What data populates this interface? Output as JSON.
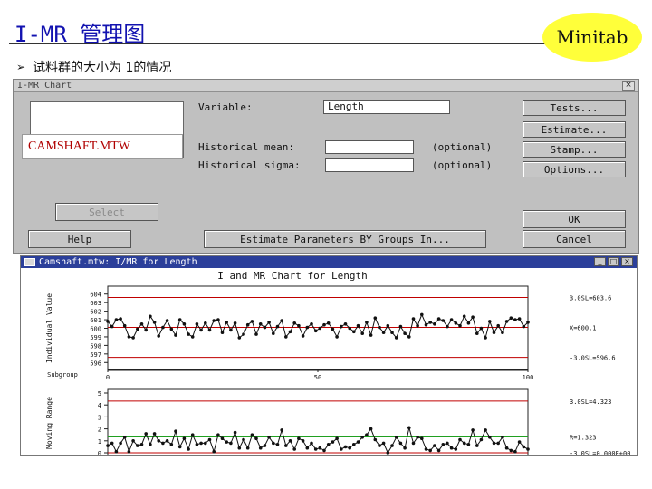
{
  "slide": {
    "title": "I-MR 管理图",
    "logo": "Minitab",
    "bullet_icon": "arrow-bullet-icon",
    "bullet": "试料群的大小为 1的情况"
  },
  "dialog": {
    "title": "I-MR Chart",
    "close": "×",
    "dataset": "CAMSHAFT.MTW",
    "variable_label": "Variable:",
    "variable_value": "Length",
    "hist_mean_label": "Historical mean:",
    "hist_mean_value": "",
    "hist_sigma_label": "Historical sigma:",
    "hist_sigma_value": "",
    "optional1": "(optional)",
    "optional2": "(optional)",
    "buttons": {
      "tests": "Tests...",
      "estimate": "Estimate...",
      "stamp": "Stamp...",
      "options": "Options...",
      "select": "Select",
      "ok": "OK",
      "help": "Help",
      "estimate_by": "Estimate Parameters BY Groups In...",
      "cancel": "Cancel"
    }
  },
  "chart_window": {
    "title": "Camshaft.mtw: I/MR for Length",
    "controls": [
      "_",
      "□",
      "×"
    ],
    "chart_title": "I and MR Chart for Length"
  },
  "chart_data": [
    {
      "type": "line",
      "ylabel": "Individual Value",
      "xlabel": "Subgroup",
      "yticks": [
        "604",
        "603",
        "602",
        "601",
        "600",
        "599",
        "598",
        "597",
        "596"
      ],
      "ylim": [
        595.5,
        604.5
      ],
      "xticks": [
        "0",
        "50",
        "100"
      ],
      "xlim": [
        0,
        100
      ],
      "limits": [
        {
          "label": "3.0SL=603.6",
          "value": 603.6,
          "color": "#c00000"
        },
        {
          "label": "X=600.1",
          "value": 600.1,
          "color": "#c00000"
        },
        {
          "label": "-3.0SL=596.6",
          "value": 596.6,
          "color": "#c00000"
        }
      ],
      "series": [
        {
          "values": [
            600.8,
            600.2,
            601.0,
            601.1,
            600.3,
            599.0,
            598.9,
            599.9,
            600.5,
            599.8,
            601.4,
            600.7,
            599.1,
            600.1,
            600.9,
            599.9,
            599.2,
            601.0,
            600.5,
            599.3,
            599.0,
            600.5,
            599.8,
            600.6,
            599.8,
            600.9,
            601.0,
            599.5,
            600.7,
            599.8,
            600.6,
            598.9,
            599.3,
            600.4,
            600.8,
            599.3,
            600.5,
            600.1,
            600.7,
            599.4,
            600.2,
            600.9,
            599.0,
            599.6,
            600.6,
            600.3,
            599.1,
            600.1,
            600.5,
            599.7,
            600.0,
            600.4,
            600.6,
            599.9,
            599.0,
            600.2,
            600.5,
            600.0,
            599.6,
            600.3,
            599.4,
            600.7,
            599.2,
            601.2,
            600.1,
            599.5,
            600.3,
            599.5,
            598.9,
            600.2,
            599.4,
            599.0,
            601.1,
            600.3,
            601.6,
            600.4,
            600.7,
            600.5,
            601.1,
            600.9,
            600.2,
            601.0,
            600.6,
            600.3,
            601.4,
            600.6,
            601.3,
            599.4,
            600.0,
            598.9,
            600.8,
            599.5,
            600.3,
            599.5,
            600.8,
            601.2,
            601.0,
            601.1,
            600.2,
            600.7
          ]
        }
      ]
    },
    {
      "type": "line",
      "ylabel": "Moving Range",
      "yticks": [
        "5",
        "4",
        "3",
        "2",
        "1",
        "0"
      ],
      "ylim": [
        0,
        5
      ],
      "xlim": [
        0,
        100
      ],
      "limits": [
        {
          "label": "3.0SL=4.323",
          "value": 4.323,
          "color": "#c00000"
        },
        {
          "label": "R=1.323",
          "value": 1.323,
          "color": "#20a020"
        },
        {
          "label": "-3.0SL=0.000E+00",
          "value": 0.0,
          "color": "#c00000"
        }
      ],
      "series": [
        {
          "values": [
            0.6,
            0.8,
            0.1,
            0.8,
            1.3,
            0.1,
            1.0,
            0.6,
            0.7,
            1.6,
            0.7,
            1.6,
            1.0,
            0.8,
            1.0,
            0.7,
            1.8,
            0.5,
            1.2,
            0.3,
            1.5,
            0.7,
            0.8,
            0.8,
            1.1,
            0.1,
            1.5,
            1.2,
            0.9,
            0.8,
            1.7,
            0.4,
            1.1,
            0.4,
            1.5,
            1.2,
            0.4,
            0.6,
            1.3,
            0.8,
            0.7,
            1.9,
            0.6,
            1.0,
            0.3,
            1.2,
            1.0,
            0.4,
            0.8,
            0.3,
            0.4,
            0.2,
            0.7,
            0.9,
            1.2,
            0.3,
            0.5,
            0.4,
            0.7,
            0.9,
            1.3,
            1.5,
            2.0,
            1.1,
            0.6,
            0.8,
            0.0,
            0.6,
            1.3,
            0.8,
            0.4,
            2.1,
            0.8,
            1.3,
            1.2,
            0.3,
            0.2,
            0.6,
            0.2,
            0.7,
            0.8,
            0.4,
            0.3,
            1.1,
            0.8,
            0.7,
            1.9,
            0.6,
            1.1,
            1.9,
            1.3,
            0.8,
            0.8,
            1.3,
            0.4,
            0.2,
            0.1,
            0.9,
            0.5,
            0.3
          ]
        }
      ]
    }
  ]
}
